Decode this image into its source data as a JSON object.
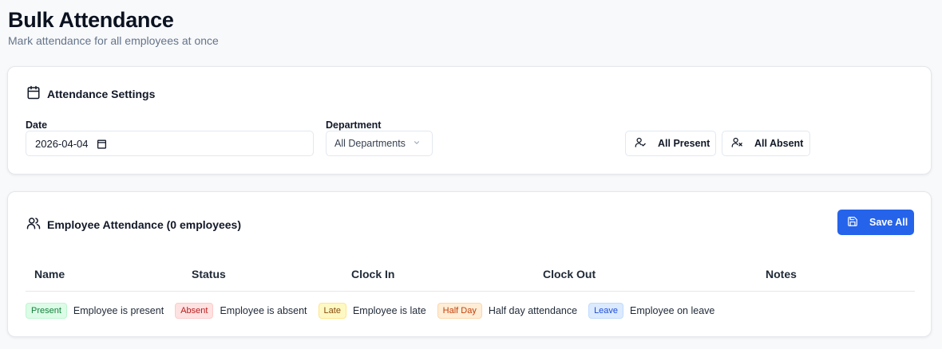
{
  "header": {
    "title": "Bulk Attendance",
    "subtitle": "Mark attendance for all employees at once"
  },
  "settings": {
    "title": "Attendance Settings",
    "title_icon": "calendar-icon",
    "date_label": "Date",
    "date_value": "2026-04-04",
    "department_label": "Department",
    "department_value": "All Departments",
    "all_present_label": "All Present",
    "all_present_icon": "user-check-icon",
    "all_absent_label": "All Absent",
    "all_absent_icon": "user-x-icon"
  },
  "attendance": {
    "title": "Employee Attendance (0 employees)",
    "title_icon": "users-icon",
    "save_label": "Save All",
    "save_icon": "save-icon",
    "columns": [
      "Name",
      "Status",
      "Clock In",
      "Clock Out",
      "Notes"
    ],
    "legend": [
      {
        "badge": "Present",
        "text": "Employee is present",
        "bg": "#dcfce7",
        "fg": "#15803d",
        "border": "#bbf7d0"
      },
      {
        "badge": "Absent",
        "text": "Employee is absent",
        "bg": "#fee2e2",
        "fg": "#b91c1c",
        "border": "#fecaca"
      },
      {
        "badge": "Late",
        "text": "Employee is late",
        "bg": "#fef9c3",
        "fg": "#854d0e",
        "border": "#fde68a"
      },
      {
        "badge": "Half Day",
        "text": "Half day attendance",
        "bg": "#ffedd5",
        "fg": "#c2410c",
        "border": "#fed7aa"
      },
      {
        "badge": "Leave",
        "text": "Employee on leave",
        "bg": "#dbeafe",
        "fg": "#1d4ed8",
        "border": "#bfdbfe"
      }
    ]
  },
  "colors": {
    "accent": "#2563eb",
    "background": "#f8f9fb"
  }
}
